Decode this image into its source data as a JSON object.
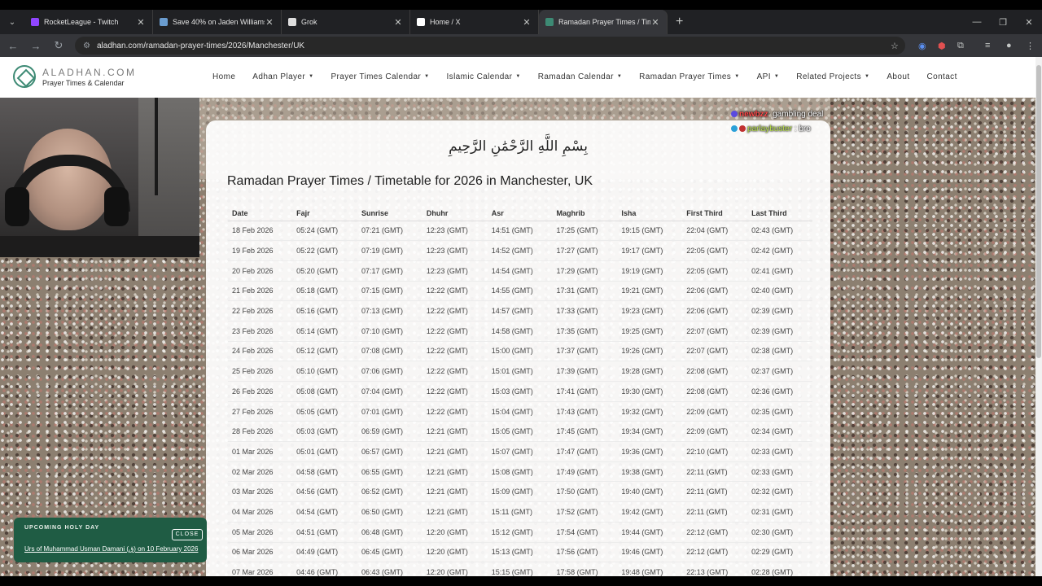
{
  "browser": {
    "tabs": [
      {
        "title": "RocketLeague - Twitch",
        "favicon_color": "#9146ff",
        "active": false
      },
      {
        "title": "Save 40% on Jaden Williams' Th",
        "favicon_color": "#6a9ccf",
        "active": false
      },
      {
        "title": "Grok",
        "favicon_color": "#dddddd",
        "active": false
      },
      {
        "title": "Home / X",
        "favicon_color": "#ffffff",
        "active": false
      },
      {
        "title": "Ramadan Prayer Times / Timeta",
        "favicon_color": "#3d8a74",
        "active": true
      }
    ],
    "url": "aladhan.com/ramadan-prayer-times/2026/Manchester/UK"
  },
  "site": {
    "logo_name": "ALADHAN.COM",
    "logo_sub": "Prayer Times & Calendar",
    "menu": [
      {
        "label": "Home",
        "dropdown": false
      },
      {
        "label": "Adhan Player",
        "dropdown": true
      },
      {
        "label": "Prayer Times Calendar",
        "dropdown": true
      },
      {
        "label": "Islamic Calendar",
        "dropdown": true
      },
      {
        "label": "Ramadan Calendar",
        "dropdown": true
      },
      {
        "label": "Ramadan Prayer Times",
        "dropdown": true
      },
      {
        "label": "API",
        "dropdown": true
      },
      {
        "label": "Related Projects",
        "dropdown": true
      },
      {
        "label": "About",
        "dropdown": false
      },
      {
        "label": "Contact",
        "dropdown": false
      }
    ]
  },
  "chat": [
    {
      "user": "newbzz",
      "message": ": gambling deal",
      "color": "#ff4a4a"
    },
    {
      "user": "parlaybuster",
      "message": ": bro",
      "color": "#b8e04a"
    }
  ],
  "content": {
    "bismillah": "بِسْمِ اللَّهِ الرَّحْمَٰنِ الرَّحِيمِ",
    "title": "Ramadan Prayer Times / Timetable for 2026 in Manchester, UK",
    "columns": [
      "Date",
      "Fajr",
      "Sunrise",
      "Dhuhr",
      "Asr",
      "Maghrib",
      "Isha",
      "First Third",
      "Last Third"
    ],
    "rows": [
      [
        "18 Feb 2026",
        "05:24 (GMT)",
        "07:21 (GMT)",
        "12:23 (GMT)",
        "14:51 (GMT)",
        "17:25 (GMT)",
        "19:15 (GMT)",
        "22:04 (GMT)",
        "02:43 (GMT)"
      ],
      [
        "19 Feb 2026",
        "05:22 (GMT)",
        "07:19 (GMT)",
        "12:23 (GMT)",
        "14:52 (GMT)",
        "17:27 (GMT)",
        "19:17 (GMT)",
        "22:05 (GMT)",
        "02:42 (GMT)"
      ],
      [
        "20 Feb 2026",
        "05:20 (GMT)",
        "07:17 (GMT)",
        "12:23 (GMT)",
        "14:54 (GMT)",
        "17:29 (GMT)",
        "19:19 (GMT)",
        "22:05 (GMT)",
        "02:41 (GMT)"
      ],
      [
        "21 Feb 2026",
        "05:18 (GMT)",
        "07:15 (GMT)",
        "12:22 (GMT)",
        "14:55 (GMT)",
        "17:31 (GMT)",
        "19:21 (GMT)",
        "22:06 (GMT)",
        "02:40 (GMT)"
      ],
      [
        "22 Feb 2026",
        "05:16 (GMT)",
        "07:13 (GMT)",
        "12:22 (GMT)",
        "14:57 (GMT)",
        "17:33 (GMT)",
        "19:23 (GMT)",
        "22:06 (GMT)",
        "02:39 (GMT)"
      ],
      [
        "23 Feb 2026",
        "05:14 (GMT)",
        "07:10 (GMT)",
        "12:22 (GMT)",
        "14:58 (GMT)",
        "17:35 (GMT)",
        "19:25 (GMT)",
        "22:07 (GMT)",
        "02:39 (GMT)"
      ],
      [
        "24 Feb 2026",
        "05:12 (GMT)",
        "07:08 (GMT)",
        "12:22 (GMT)",
        "15:00 (GMT)",
        "17:37 (GMT)",
        "19:26 (GMT)",
        "22:07 (GMT)",
        "02:38 (GMT)"
      ],
      [
        "25 Feb 2026",
        "05:10 (GMT)",
        "07:06 (GMT)",
        "12:22 (GMT)",
        "15:01 (GMT)",
        "17:39 (GMT)",
        "19:28 (GMT)",
        "22:08 (GMT)",
        "02:37 (GMT)"
      ],
      [
        "26 Feb 2026",
        "05:08 (GMT)",
        "07:04 (GMT)",
        "12:22 (GMT)",
        "15:03 (GMT)",
        "17:41 (GMT)",
        "19:30 (GMT)",
        "22:08 (GMT)",
        "02:36 (GMT)"
      ],
      [
        "27 Feb 2026",
        "05:05 (GMT)",
        "07:01 (GMT)",
        "12:22 (GMT)",
        "15:04 (GMT)",
        "17:43 (GMT)",
        "19:32 (GMT)",
        "22:09 (GMT)",
        "02:35 (GMT)"
      ],
      [
        "28 Feb 2026",
        "05:03 (GMT)",
        "06:59 (GMT)",
        "12:21 (GMT)",
        "15:05 (GMT)",
        "17:45 (GMT)",
        "19:34 (GMT)",
        "22:09 (GMT)",
        "02:34 (GMT)"
      ],
      [
        "01 Mar 2026",
        "05:01 (GMT)",
        "06:57 (GMT)",
        "12:21 (GMT)",
        "15:07 (GMT)",
        "17:47 (GMT)",
        "19:36 (GMT)",
        "22:10 (GMT)",
        "02:33 (GMT)"
      ],
      [
        "02 Mar 2026",
        "04:58 (GMT)",
        "06:55 (GMT)",
        "12:21 (GMT)",
        "15:08 (GMT)",
        "17:49 (GMT)",
        "19:38 (GMT)",
        "22:11 (GMT)",
        "02:33 (GMT)"
      ],
      [
        "03 Mar 2026",
        "04:56 (GMT)",
        "06:52 (GMT)",
        "12:21 (GMT)",
        "15:09 (GMT)",
        "17:50 (GMT)",
        "19:40 (GMT)",
        "22:11 (GMT)",
        "02:32 (GMT)"
      ],
      [
        "04 Mar 2026",
        "04:54 (GMT)",
        "06:50 (GMT)",
        "12:21 (GMT)",
        "15:11 (GMT)",
        "17:52 (GMT)",
        "19:42 (GMT)",
        "22:11 (GMT)",
        "02:31 (GMT)"
      ],
      [
        "05 Mar 2026",
        "04:51 (GMT)",
        "06:48 (GMT)",
        "12:20 (GMT)",
        "15:12 (GMT)",
        "17:54 (GMT)",
        "19:44 (GMT)",
        "22:12 (GMT)",
        "02:30 (GMT)"
      ],
      [
        "06 Mar 2026",
        "04:49 (GMT)",
        "06:45 (GMT)",
        "12:20 (GMT)",
        "15:13 (GMT)",
        "17:56 (GMT)",
        "19:46 (GMT)",
        "22:12 (GMT)",
        "02:29 (GMT)"
      ],
      [
        "07 Mar 2026",
        "04:46 (GMT)",
        "06:43 (GMT)",
        "12:20 (GMT)",
        "15:15 (GMT)",
        "17:58 (GMT)",
        "19:48 (GMT)",
        "22:13 (GMT)",
        "02:28 (GMT)"
      ]
    ]
  },
  "holy_day": {
    "label": "UPCOMING HOLY DAY",
    "close_label": "CLOSE",
    "link_text": "Urs of Muhammad Usman Damani (ق) on 10 February 2026"
  }
}
